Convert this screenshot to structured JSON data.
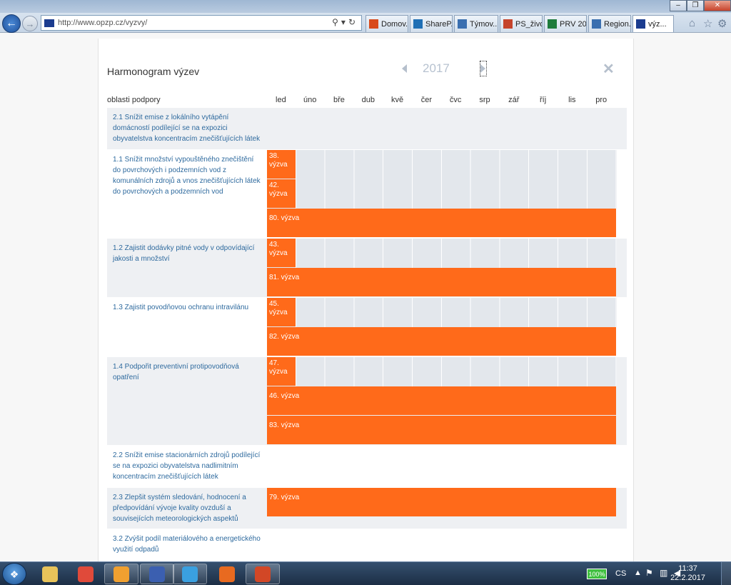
{
  "browser": {
    "address": "http://www.opzp.cz/vyzvy/",
    "tabs": [
      {
        "label": "Domov...",
        "color": "#d84a1b"
      },
      {
        "label": "ShareP...",
        "color": "#1f6fb5"
      },
      {
        "label": "Týmov...",
        "color": "#3a6fb0"
      },
      {
        "label": "PS_živo...",
        "color": "#c5432b"
      },
      {
        "label": "PRV 20...",
        "color": "#1e7b3c"
      },
      {
        "label": "Region...",
        "color": "#3a6fb0"
      },
      {
        "label": "výz...",
        "color": "#1b3c8f",
        "active": true
      }
    ]
  },
  "modal": {
    "title": "Harmonogram výzev",
    "year": "2017",
    "areas_header": "oblasti podpory",
    "months": [
      "led",
      "úno",
      "bře",
      "dub",
      "kvě",
      "čer",
      "čvc",
      "srp",
      "zář",
      "říj",
      "lis",
      "pro"
    ],
    "rows": [
      {
        "label": "2.1 Snížit emise z lokálního vytápění domácností podílející se na expozici obyvatelstva koncentracím znečišťujících látek",
        "shaded": true,
        "tracks": []
      },
      {
        "label": "1.1 Snížit množství vypouštěného znečištění do povrchových i podzemních vod z komunálních zdrojů a vnos znečišťujících látek do povrchových a podzemních vod",
        "shaded": false,
        "tracks": [
          {
            "call": "38. výzva",
            "months": 1
          },
          {
            "call": "42. výzva",
            "months": 1
          },
          {
            "call": "80. výzva",
            "months": 12
          }
        ]
      },
      {
        "label": "1.2 Zajistit dodávky pitné vody v odpovídající jakosti a množství",
        "shaded": true,
        "tracks": [
          {
            "call": "43. výzva",
            "months": 1
          },
          {
            "call": "81. výzva",
            "months": 12
          }
        ]
      },
      {
        "label": "1.3 Zajistit povodňovou ochranu intravilánu",
        "shaded": false,
        "tracks": [
          {
            "call": "45. výzva",
            "months": 1
          },
          {
            "call": "82. výzva",
            "months": 12
          }
        ]
      },
      {
        "label": "1.4 Podpořit preventivní protipovodňová opatření",
        "shaded": true,
        "tracks": [
          {
            "call": "47. výzva",
            "months": 1
          },
          {
            "call": "46. výzva",
            "months": 12
          },
          {
            "call": "83. výzva",
            "months": 12
          }
        ]
      },
      {
        "label": "2.2 Snížit emise stacionárních zdrojů podílející se na expozici obyvatelstva nadlimitním koncentracím znečišťujících látek",
        "shaded": false,
        "tracks": []
      },
      {
        "label": "2.3 Zlepšit systém sledování, hodnocení a předpovídání vývoje kvality ovzduší a souvisejících meteorologických aspektů",
        "shaded": true,
        "tracks": [
          {
            "call": "79. výzva",
            "months": 12
          }
        ]
      },
      {
        "label": "3.2 Zvýšit podíl materiálového a energetického využití odpadů",
        "shaded": false,
        "tracks": []
      }
    ]
  },
  "taskbar": {
    "apps": [
      {
        "name": "explorer",
        "color": "#e8c35a"
      },
      {
        "name": "chrome",
        "color": "#e04a3a"
      },
      {
        "name": "outlook",
        "color": "#f0a030"
      },
      {
        "name": "floppy",
        "color": "#3b5fb0"
      },
      {
        "name": "internet-explorer",
        "color": "#3aa0e0"
      },
      {
        "name": "firefox",
        "color": "#e86a20"
      },
      {
        "name": "powerpoint",
        "color": "#d24726"
      }
    ],
    "battery": "100%",
    "language": "CS",
    "time": "11:37",
    "date": "22.2.2017"
  }
}
